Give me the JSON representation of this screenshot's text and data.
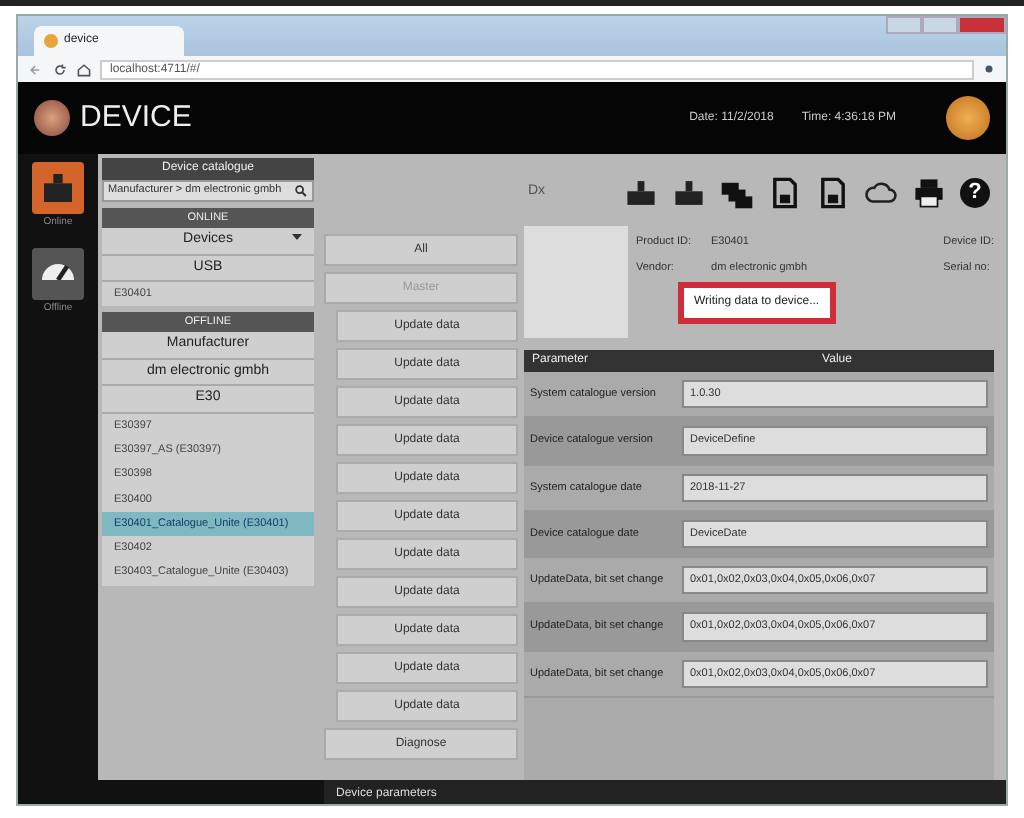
{
  "browser": {
    "tab_title": "device",
    "address": "localhost:4711/#/"
  },
  "header": {
    "brand": "DEVICE",
    "date": "Date: 11/2/2018",
    "time": "Time: 4:36:18 PM"
  },
  "rail": [
    {
      "label": "Online",
      "kind": "device",
      "selected": true
    },
    {
      "label": "Offline",
      "kind": "gauge",
      "selected": false
    }
  ],
  "catalogue": {
    "title": "Device catalogue",
    "search": "Manufacturer > dm electronic gmbh",
    "sections": [
      {
        "title": "ONLINE",
        "groups": [
          {
            "label": "Devices",
            "caret": true
          },
          {
            "label": "USB",
            "caret": false
          }
        ],
        "items": [
          {
            "label": "E30401",
            "selected": false
          }
        ]
      },
      {
        "title": "OFFLINE",
        "groups": [
          {
            "label": "Manufacturer",
            "caret": false
          },
          {
            "label": "dm electronic gmbh",
            "caret": false
          },
          {
            "label": "E30",
            "caret": false
          }
        ],
        "items": [
          {
            "label": "E30397",
            "selected": false
          },
          {
            "label": "E30397_AS (E30397)",
            "selected": false
          },
          {
            "label": "E30398",
            "selected": false
          },
          {
            "label": "E30400",
            "selected": false
          },
          {
            "label": "E30401_Catalogue_Unite (E30401)",
            "selected": true
          },
          {
            "label": "E30402",
            "selected": false
          },
          {
            "label": "E30403_Catalogue_Unite (E30403)",
            "selected": false
          }
        ]
      }
    ]
  },
  "actions": [
    {
      "label": "All",
      "kind": "head",
      "disabled": false
    },
    {
      "label": "Master",
      "kind": "head",
      "disabled": true
    },
    {
      "label": "Update data",
      "kind": "item",
      "disabled": false
    },
    {
      "label": "Update data",
      "kind": "item",
      "disabled": false
    },
    {
      "label": "Update data",
      "kind": "item",
      "disabled": false
    },
    {
      "label": "Update data",
      "kind": "item",
      "disabled": false
    },
    {
      "label": "Update data",
      "kind": "item",
      "disabled": false
    },
    {
      "label": "Update data",
      "kind": "item",
      "disabled": false
    },
    {
      "label": "Update data",
      "kind": "item",
      "disabled": false
    },
    {
      "label": "Update data",
      "kind": "item",
      "disabled": false
    },
    {
      "label": "Update data",
      "kind": "item",
      "disabled": false
    },
    {
      "label": "Update data",
      "kind": "item",
      "disabled": false
    },
    {
      "label": "Update data",
      "kind": "item",
      "disabled": false
    },
    {
      "label": "Diagnose",
      "kind": "head",
      "disabled": false
    }
  ],
  "toolbar": {
    "label": "Dx",
    "buttons": [
      {
        "kind": "upload"
      },
      {
        "kind": "download"
      },
      {
        "kind": "devices"
      },
      {
        "kind": "save"
      },
      {
        "kind": "save"
      },
      {
        "kind": "cloud"
      },
      {
        "kind": "print"
      },
      {
        "kind": "help",
        "label": "?"
      }
    ]
  },
  "device": {
    "fields": [
      {
        "label": "Product ID:",
        "value": "E30401"
      },
      {
        "label": "Vendor:",
        "value": "dm electronic gmbh"
      }
    ],
    "side_labels": [
      "Device ID:",
      "Serial no:"
    ]
  },
  "table": {
    "columns": [
      "Parameter",
      "Value"
    ],
    "rows": [
      {
        "parameter": "System catalogue version",
        "value": "1.0.30"
      },
      {
        "parameter": "Device catalogue version",
        "value": "DeviceDefine"
      },
      {
        "parameter": "System catalogue date",
        "value": "2018-11-27"
      },
      {
        "parameter": "Device catalogue date",
        "value": "DeviceDate"
      },
      {
        "parameter": "UpdateData, bit set change",
        "value": "0x01,0x02,0x03,0x04,0x05,0x06,0x07"
      },
      {
        "parameter": "UpdateData, bit set change",
        "value": "0x01,0x02,0x03,0x04,0x05,0x06,0x07"
      },
      {
        "parameter": "UpdateData, bit set change",
        "value": "0x01,0x02,0x03,0x04,0x05,0x06,0x07"
      }
    ]
  },
  "popup": {
    "text": "Writing data to device..."
  },
  "footer": {
    "title": "Device parameters"
  }
}
